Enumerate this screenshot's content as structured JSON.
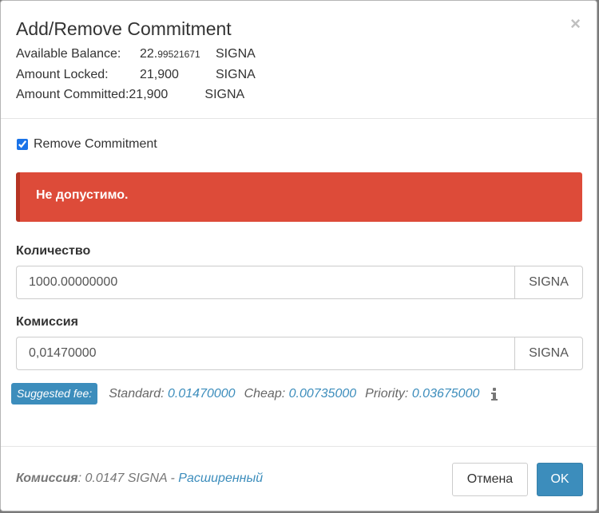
{
  "modal": {
    "title": "Add/Remove Commitment",
    "close_symbol": "×",
    "close_icon": "close-icon"
  },
  "info": {
    "available_label": "Available Balance:",
    "available_int": "22.",
    "available_frac": "99521671",
    "available_unit": "SIGNA",
    "locked_label": "Amount Locked:",
    "locked_value": "21,900",
    "locked_unit": "SIGNA",
    "committed_label": "Amount Committed:",
    "committed_value": "21,900",
    "committed_unit": "SIGNA"
  },
  "remove_commitment": {
    "label": "Remove Commitment",
    "checked": true
  },
  "alert": {
    "message": "Не допустимо.",
    "color": "#dd4b39"
  },
  "amount": {
    "label": "Количество",
    "value": "1000.00000000",
    "unit": "SIGNA"
  },
  "fee": {
    "label": "Комиссия",
    "value": "0,01470000",
    "unit": "SIGNA"
  },
  "suggested": {
    "badge": "Suggested fee:",
    "standard_label": "Standard:",
    "standard_value": "0.01470000",
    "cheap_label": "Cheap:",
    "cheap_value": "0.00735000",
    "priority_label": "Priority:",
    "priority_value": "0.03675000",
    "info_icon": "info-icon"
  },
  "footer": {
    "fee_label": "Комиссия",
    "fee_text": ": 0.0147 SIGNA - ",
    "advanced_link": "Расширенный",
    "cancel_label": "Отмена",
    "ok_label": "OK"
  },
  "colors": {
    "accent": "#3c8dbc",
    "danger": "#dd4b39"
  }
}
